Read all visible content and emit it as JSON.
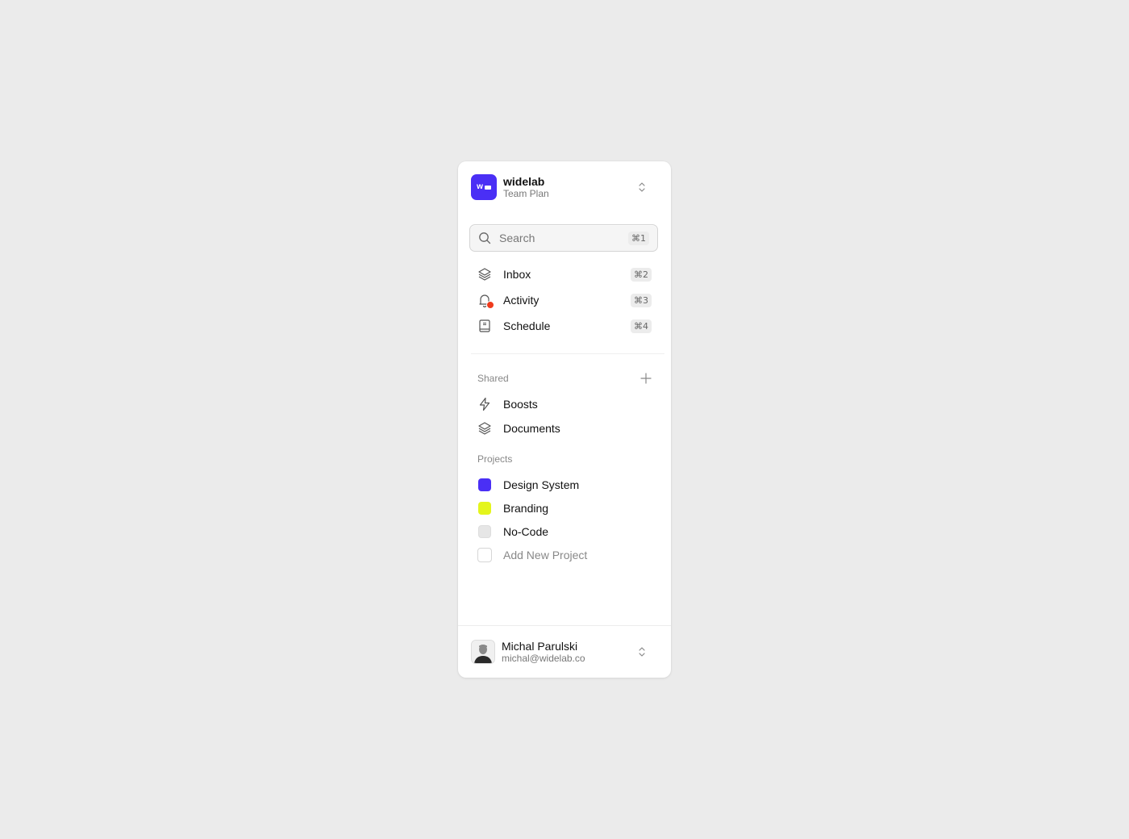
{
  "workspace": {
    "name": "widelab",
    "plan": "Team Plan",
    "logo_text": "w",
    "brand_color": "#4a2ff5"
  },
  "search": {
    "placeholder": "Search",
    "shortcut": "⌘1"
  },
  "nav": [
    {
      "label": "Inbox",
      "icon": "layers-icon",
      "shortcut": "⌘2"
    },
    {
      "label": "Activity",
      "icon": "bell-icon",
      "shortcut": "⌘3",
      "notification": true
    },
    {
      "label": "Schedule",
      "icon": "book-icon",
      "shortcut": "⌘4"
    }
  ],
  "shared": {
    "heading": "Shared",
    "items": [
      {
        "label": "Boosts",
        "icon": "lightning-icon"
      },
      {
        "label": "Documents",
        "icon": "layers-icon"
      }
    ]
  },
  "projects": {
    "heading": "Projects",
    "items": [
      {
        "label": "Design System",
        "color": "#4a2ff5"
      },
      {
        "label": "Branding",
        "color": "#e4f51c"
      },
      {
        "label": "No-Code",
        "color": "#e6e6e6"
      }
    ],
    "add_label": "Add New Project"
  },
  "user": {
    "name": "Michal Parulski",
    "email": "michal@widelab.co"
  }
}
